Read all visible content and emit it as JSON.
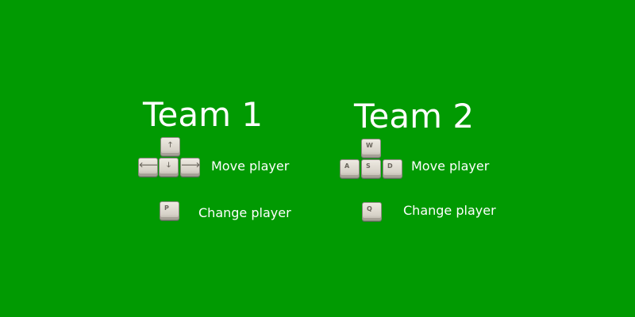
{
  "team1": {
    "title": "Team 1",
    "move_label": "Move player",
    "change_label": "Change player",
    "keys": {
      "up": "🡑",
      "left": "🡐",
      "down": "🡓",
      "right": "🡒",
      "change": "P"
    }
  },
  "team2": {
    "title": "Team 2",
    "move_label": "Move player",
    "change_label": "Change player",
    "keys": {
      "up": "W",
      "left": "A",
      "down": "S",
      "right": "D",
      "change": "Q"
    }
  },
  "colors": {
    "background": "#019a02",
    "text": "#ffffff",
    "key_face": "#e3dfd6"
  }
}
